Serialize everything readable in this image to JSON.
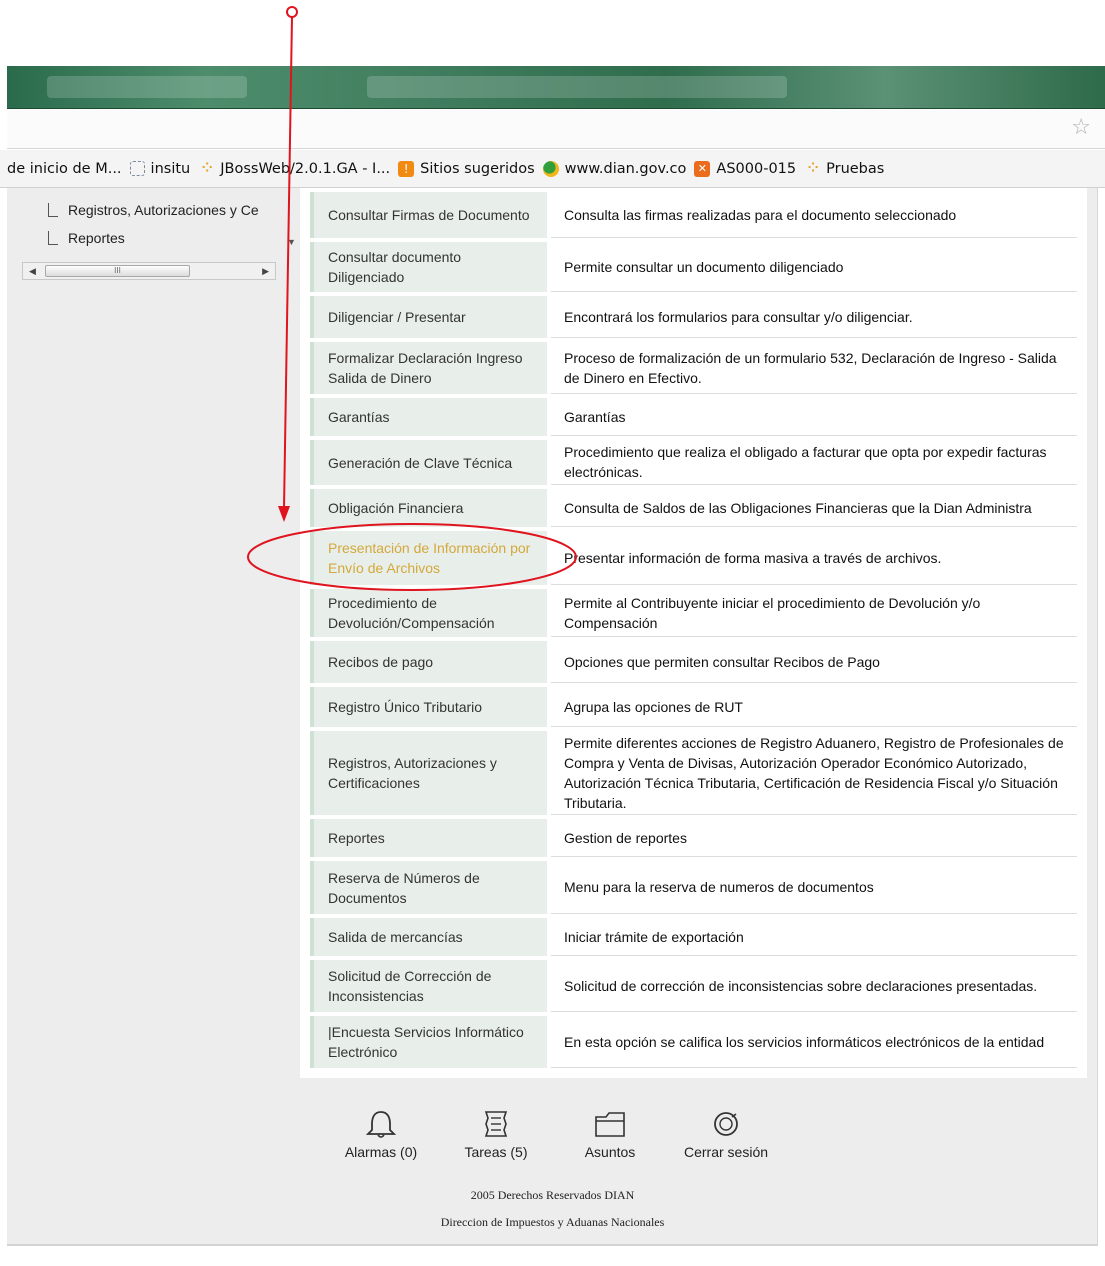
{
  "bookmarks": [
    {
      "label": "de inicio de M...",
      "icon": "none"
    },
    {
      "label": "insitu",
      "icon": "dashed-page-icon"
    },
    {
      "label": "JBossWeb/2.0.1.GA - I...",
      "icon": "dots-icon"
    },
    {
      "label": "Sitios sugeridos",
      "icon": "bulb-icon"
    },
    {
      "label": "www.dian.gov.co",
      "icon": "dian-logo-icon"
    },
    {
      "label": "AS000-015",
      "icon": "calendar-icon"
    },
    {
      "label": "Pruebas",
      "icon": "dots-icon"
    }
  ],
  "tree": {
    "items": [
      "Registros, Autorizaciones y Ce",
      "Reportes"
    ],
    "scrollbar_grip": "III"
  },
  "menu": [
    {
      "name": "Consultar Firmas de Documento",
      "description": "Consulta las firmas realizadas para el documento seleccionado"
    },
    {
      "name": "Consultar documento Diligenciado",
      "description": "Permite consultar un documento diligenciado"
    },
    {
      "name": "Diligenciar / Presentar",
      "description": "Encontrará los formularios para consultar y/o diligenciar."
    },
    {
      "name": "Formalizar Declaración Ingreso Salida de Dinero",
      "description": "Proceso de formalización de un formulario 532, Declaración de Ingreso - Salida de Dinero en Efectivo."
    },
    {
      "name": "Garantías",
      "description": "Garantías"
    },
    {
      "name": "Generación de Clave Técnica",
      "description": "Procedimiento que realiza el obligado a facturar que opta por expedir facturas electrónicas."
    },
    {
      "name": "Obligación Financiera",
      "description": "Consulta de Saldos de las Obligaciones Financieras que la Dian Administra"
    },
    {
      "name": "Presentación de Información por Envío de Archivos",
      "description": "Presentar información de forma masiva a través de archivos.",
      "highlighted": true
    },
    {
      "name": "Procedimiento de Devolución/Compensación",
      "description": "Permite al Contribuyente iniciar el procedimiento de Devolución y/o Compensación"
    },
    {
      "name": "Recibos de pago",
      "description": "Opciones que permiten consultar Recibos de Pago"
    },
    {
      "name": "Registro Único Tributario",
      "description": "Agrupa las opciones de RUT"
    },
    {
      "name": "Registros, Autorizaciones y Certificaciones",
      "description": "Permite diferentes acciones de Registro Aduanero, Registro de Profesionales de Compra y Venta de Divisas, Autorización Operador Económico Autorizado, Autorización Técnica Tributaria, Certificación de Residencia Fiscal y/o Situación Tributaria."
    },
    {
      "name": "Reportes",
      "description": "Gestion de reportes"
    },
    {
      "name": "Reserva de Números de Documentos",
      "description": "Menu para la reserva de numeros de documentos"
    },
    {
      "name": "Salida de mercancías",
      "description": "Iniciar trámite de exportación"
    },
    {
      "name": "Solicitud de Corrección de Inconsistencias",
      "description": "Solicitud de corrección de inconsistencias sobre declaraciones presentadas."
    },
    {
      "name": "|Encuesta Servicios Informático Electrónico",
      "description": "En esta opción se califica los servicios informáticos electrónicos de la entidad"
    }
  ],
  "footer": {
    "actions": [
      {
        "label": "Alarmas (0)",
        "icon": "bell-icon"
      },
      {
        "label": "Tareas (5)",
        "icon": "scroll-icon"
      },
      {
        "label": "Asuntos",
        "icon": "folder-icon"
      },
      {
        "label": "Cerrar sesión",
        "icon": "power-icon"
      }
    ],
    "copyright": "2005 Derechos Reservados DIAN",
    "org": "Direccion de Impuestos y Aduanas Nacionales"
  },
  "colors": {
    "titlebar": "#2f6d4d",
    "menu_name_bg": "#e8efea",
    "highlight_text": "#d4a83a",
    "annotation_red": "#e0141e"
  }
}
